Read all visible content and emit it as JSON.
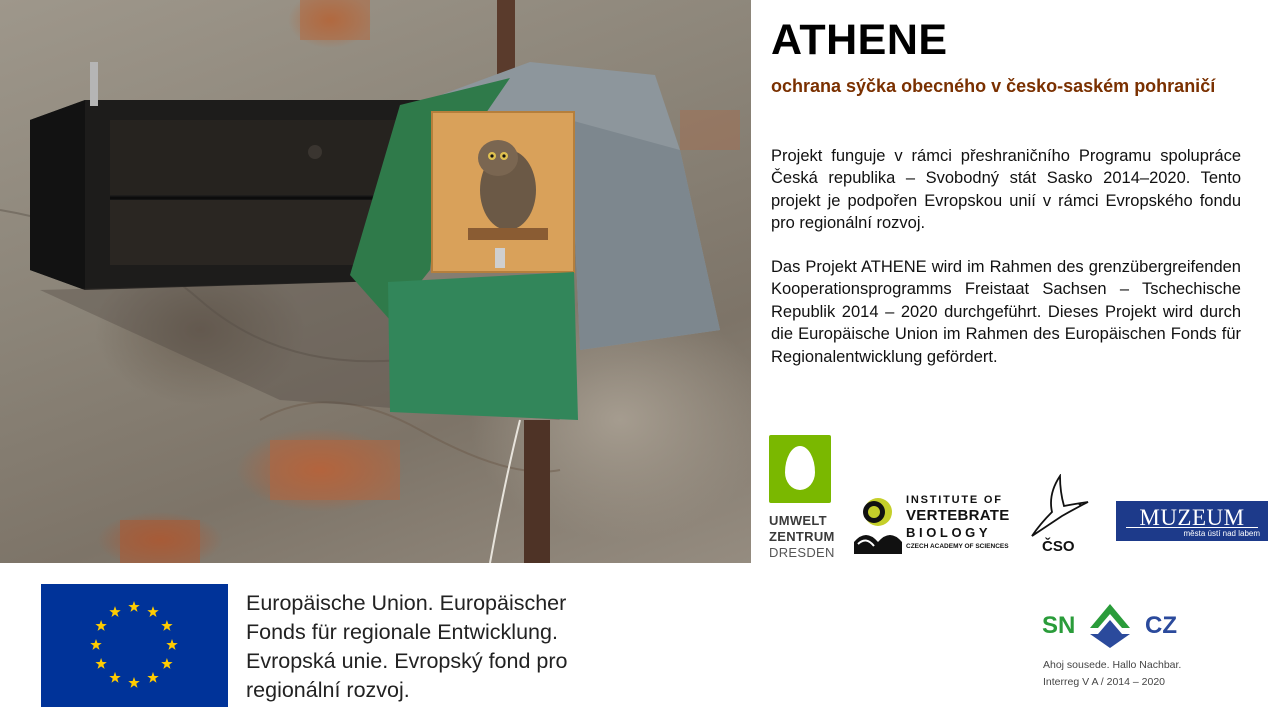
{
  "slide": {
    "photo_alt": "",
    "title": "ATHENE",
    "subtitle": "ochrana sýčka obecného v česko-saském pohraničí",
    "paragraph_cz": "Projekt funguje v rámci přeshraničního Programu spolupráce Česká republika – Svobodný stát Sasko 2014–2020. Tento projekt je podpořen Evropskou unií v rámci Evropského fondu pro regionální rozvoj.",
    "paragraph_de": "Das Projekt ATHENE wird im Rahmen des grenzübergreifenden Kooperationsprogramms Freistaat Sachsen – Tschechische Republik 2014 – 2020 durchgeführt. Dieses Projekt wird durch die Europäische Union im Rahmen des Europäischen Fonds für Regionalentwicklung gefördert."
  },
  "logos": {
    "umweltzentrum": {
      "line1": "UMWELT",
      "line2": "ZENTRUM",
      "line3": "DRESDEN",
      "color": "#7ab800"
    },
    "ivb": {
      "line1": "INSTITUTE OF",
      "line2": "VERTEBRATE",
      "line3": "BIOLOGY",
      "line4": "CZECH ACADEMY OF SCIENCES"
    },
    "cso": {
      "label": "ČSO"
    },
    "muzeum": {
      "line1": "MUZEUM",
      "line2": "města ústí nad labem",
      "color": "#1d3a8a"
    },
    "sncz": {
      "left": "SN",
      "right": "CZ",
      "tagline": "Ahoj sousede. Hallo Nachbar.",
      "program": "Interreg V A / 2014 – 2020"
    }
  },
  "eu": {
    "text_line1": "Europäische Union. Europäischer",
    "text_line2": "Fonds für regionale Entwicklung.",
    "text_line3": "Evropská unie. Evropský fond pro",
    "text_line4": "regionální rozvoj.",
    "flag_color": "#003399",
    "star_color": "#ffcc00"
  }
}
